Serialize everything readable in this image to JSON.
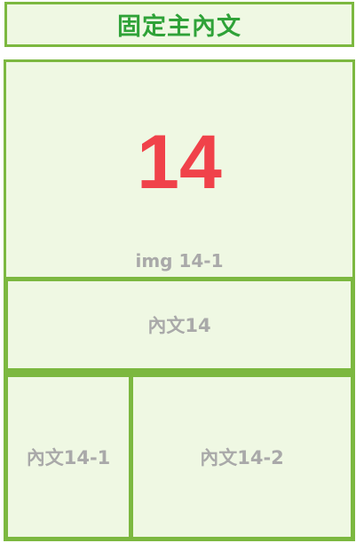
{
  "header": {
    "title": "固定主內文"
  },
  "image_panel": {
    "number": "14",
    "caption": "img 14-1"
  },
  "content": {
    "main_label": "內文14",
    "sub_left_label": "內文14-1",
    "sub_right_label": "內文14-2"
  },
  "colors": {
    "panel_background": "#eff8e3",
    "border": "#7cb840",
    "header_text": "#2fa238",
    "number": "#f0424a",
    "muted_text": "#a9a9a9"
  }
}
